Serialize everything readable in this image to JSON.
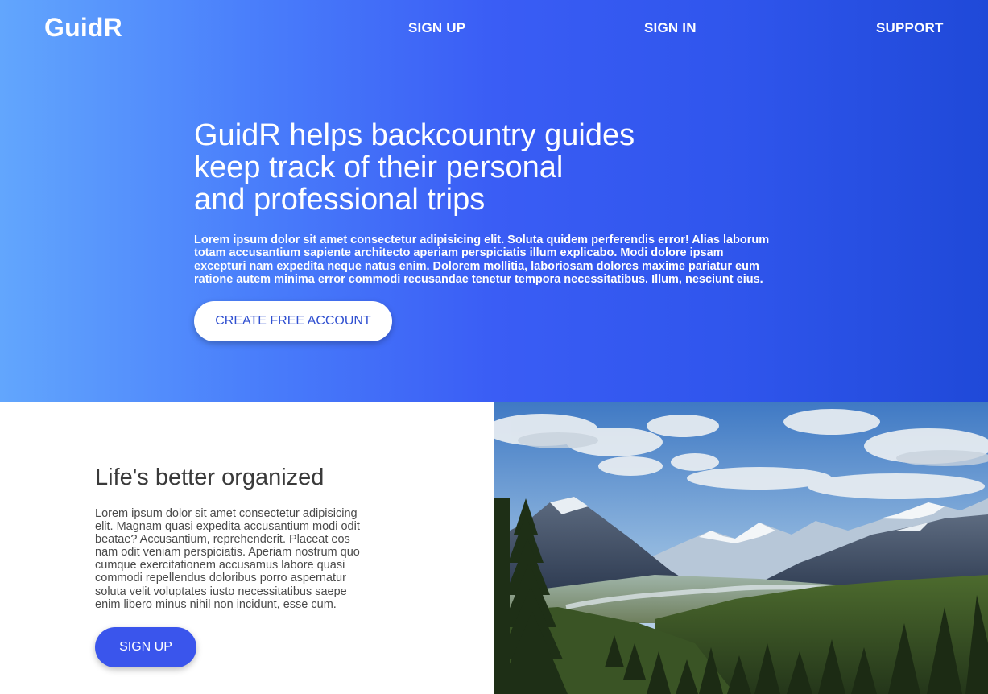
{
  "header": {
    "brand": "GuidR",
    "nav": {
      "sign_up": "SIGN UP",
      "sign_in": "SIGN IN",
      "support": "SUPPORT"
    }
  },
  "hero": {
    "title_lines": [
      "GuidR helps backcountry guides",
      "keep track of their personal",
      "and professional trips"
    ],
    "text_lines": [
      "Lorem ipsum dolor sit amet consectetur adipisicing elit. Soluta quidem perferendis error! Alias laborum",
      "totam accusantium sapiente architecto aperiam perspiciatis illum explicabo. Modi dolore ipsam",
      "excepturi nam expedita neque natus enim. Dolorem mollitia, laboriosam dolores maxime pariatur eum",
      "ratione autem minima error commodi recusandae tenetur tempora necessitatibus. Illum, nesciunt eius."
    ],
    "cta_label": "CREATE FREE ACCOUNT"
  },
  "feature": {
    "title": "Life's better organized",
    "text_lines": [
      "Lorem ipsum dolor sit amet consectetur adipisicing",
      "elit. Magnam quasi expedita accusantium modi odit",
      "beatae? Accusantium, reprehenderit. Placeat eos",
      "nam odit veniam perspiciatis. Aperiam nostrum quo",
      "cumque exercitationem accusamus labore quasi",
      "commodi repellendus doloribus porro aspernatur",
      "soluta velit voluptates iusto necessitatibus saepe",
      "enim libero minus nihil non incidunt, esse cum."
    ],
    "cta_label": "SIGN UP"
  },
  "colors": {
    "gradient_start": "#62a6fd",
    "gradient_end": "#1f49d8",
    "accent_button": "#3a55ec",
    "hero_cta_text": "#2f4fd0"
  }
}
